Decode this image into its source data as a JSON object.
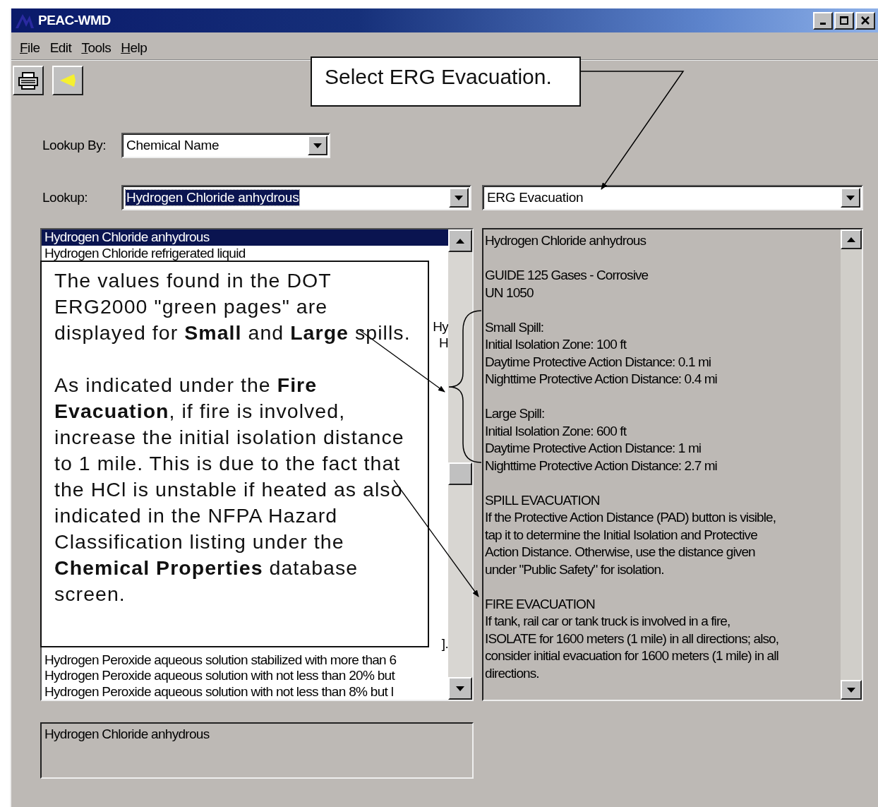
{
  "window": {
    "title": "PEAC-WMD"
  },
  "menu": [
    {
      "label": "File",
      "mnemonic": true
    },
    {
      "label": "Edit",
      "mnemonic": false
    },
    {
      "label": "Tools",
      "mnemonic": true
    },
    {
      "label": "Help",
      "mnemonic": true
    }
  ],
  "toolbar": [
    {
      "kind": "print"
    },
    {
      "kind": "back"
    }
  ],
  "lookup_by": {
    "label": "Lookup By:",
    "value": "Chemical Name",
    "text_selected": false
  },
  "lookup": {
    "label": "Lookup:",
    "value": "Hydrogen Chloride anhydrous",
    "text_selected": true
  },
  "view_select": {
    "value": "ERG Evacuation",
    "text_selected": false
  },
  "chemical_list": {
    "top_items": [
      {
        "text": "Hydrogen Chloride anhydrous",
        "selected": true
      },
      {
        "text": "Hydrogen Chloride refrigerated liquid",
        "selected": false
      }
    ],
    "peeking_items": [
      "Hy",
      "H"
    ],
    "bottom_items": [
      {
        "text": "].",
        "selected": false
      },
      {
        "text": "Hydrogen Peroxide aqueous solution stabilized with more than 6",
        "selected": false
      },
      {
        "text": "Hydrogen Peroxide aqueous solution with not less than 20% but",
        "selected": false
      },
      {
        "text": "Hydrogen Peroxide aqueous solution with not less than 8% but l",
        "selected": false
      }
    ]
  },
  "details": [
    [
      "Hydrogen Chloride anhydrous"
    ],
    [
      "GUIDE 125 Gases - Corrosive",
      "UN 1050"
    ],
    [
      "Small Spill:",
      "Initial Isolation Zone: 100 ft",
      "Daytime Protective Action Distance: 0.1 mi",
      "Nighttime Protective Action Distance: 0.4 mi"
    ],
    [
      "Large Spill:",
      "Initial Isolation Zone: 600 ft",
      "Daytime Protective Action Distance: 1 mi",
      "Nighttime Protective Action Distance: 2.7 mi"
    ],
    [
      "SPILL EVACUATION",
      "If the Protective Action Distance (PAD) button is visible,",
      "tap it to determine the Initial Isolation and Protective",
      "Action Distance.  Otherwise, use the distance given",
      "under \"Public Safety\" for isolation."
    ],
    [
      "FIRE EVACUATION",
      "If tank, rail car or tank truck is involved in a fire,",
      "ISOLATE for 1600 meters (1 mile) in all directions; also,",
      "consider initial evacuation for 1600 meters (1 mile) in all",
      "directions."
    ]
  ],
  "selection_box": {
    "value": "Hydrogen Chloride anhydrous"
  },
  "callouts": [
    {
      "kind": "top",
      "paragraphs": [
        "Select ERG Evacuation."
      ]
    },
    {
      "kind": "left",
      "paragraphs": [
        "The values found in the DOT ERG2000 \"green pages\" are displayed for **Small** and **Large** spills.",
        "As indicated under the **Fire Evacuation**, if fire is involved, increase the initial isolation distance to 1 mile.  This is due to the fact that the HCl is unstable if heated as also indicated in the NFPA Hazard Classification listing under the **Chemical Properties** database screen."
      ]
    }
  ]
}
